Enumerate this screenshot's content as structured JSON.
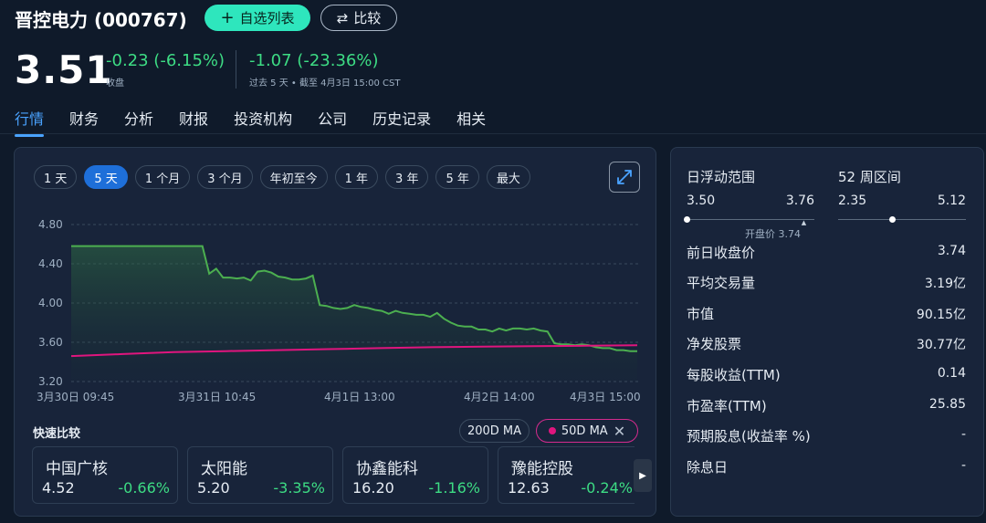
{
  "header": {
    "title": "晋控电力 (000767)",
    "watchlist_label": "自选列表",
    "compare_label": "比较",
    "price": "3.51",
    "change_today": "-0.23 (-6.15%)",
    "change_today_label": "收盘",
    "change_period": "-1.07 (-23.36%)",
    "change_period_label": "过去 5 天 • 截至 4月3日 15:00 CST"
  },
  "nav": {
    "tabs": [
      "行情",
      "财务",
      "分析",
      "财报",
      "投资机构",
      "公司",
      "历史记录",
      "相关"
    ],
    "active": "行情"
  },
  "chart_controls": {
    "ranges": [
      "1 天",
      "5 天",
      "1 个月",
      "3 个月",
      "年初至今",
      "1 年",
      "3 年",
      "5 年",
      "最大"
    ],
    "active_range": "5 天"
  },
  "chart_data": {
    "type": "line",
    "ylim": [
      3.2,
      4.8
    ],
    "yticks": [
      "4.80",
      "4.40",
      "4.00",
      "3.60",
      "3.20"
    ],
    "xtick_labels": [
      "3月30日 09:45",
      "3月31日 10:45",
      "4月1日 13:00",
      "4月2日 14:00",
      "4月3日 15:00"
    ],
    "grid": true,
    "series": [
      {
        "name": "price",
        "color": "#4caf50",
        "values": [
          4.58,
          4.58,
          4.58,
          4.58,
          4.58,
          4.58,
          4.58,
          4.58,
          4.58,
          4.58,
          4.58,
          4.58,
          4.58,
          4.58,
          4.58,
          4.58,
          4.58,
          4.58,
          4.58,
          4.58,
          4.3,
          4.35,
          4.26,
          4.26,
          4.25,
          4.26,
          4.23,
          4.32,
          4.33,
          4.31,
          4.27,
          4.26,
          4.24,
          4.24,
          4.25,
          4.28,
          3.98,
          3.97,
          3.95,
          3.94,
          3.95,
          3.98,
          3.96,
          3.95,
          3.93,
          3.92,
          3.89,
          3.92,
          3.9,
          3.89,
          3.88,
          3.88,
          3.86,
          3.9,
          3.84,
          3.8,
          3.77,
          3.76,
          3.76,
          3.73,
          3.73,
          3.71,
          3.74,
          3.72,
          3.74,
          3.74,
          3.73,
          3.74,
          3.72,
          3.71,
          3.59,
          3.58,
          3.58,
          3.57,
          3.58,
          3.57,
          3.55,
          3.54,
          3.54,
          3.52,
          3.52,
          3.51,
          3.51
        ]
      },
      {
        "name": "50D MA",
        "color": "#e0157e",
        "values": [
          3.46,
          3.48,
          3.5,
          3.51,
          3.52,
          3.53,
          3.54,
          3.55,
          3.555,
          3.56,
          3.565,
          3.57
        ]
      }
    ]
  },
  "quick_compare": {
    "title": "快速比较",
    "ma200_label": "200D MA",
    "ma50_label": "50D MA",
    "cards": [
      {
        "name": "中国广核",
        "price": "4.52",
        "change": "-0.66%"
      },
      {
        "name": "太阳能",
        "price": "5.20",
        "change": "-3.35%"
      },
      {
        "name": "协鑫能科",
        "price": "16.20",
        "change": "-1.16%"
      },
      {
        "name": "豫能控股",
        "price": "12.63",
        "change": "-0.24%"
      }
    ]
  },
  "stats": {
    "day_range_label": "日浮动范围",
    "day_low": "3.50",
    "day_high": "3.76",
    "open_label": "开盘价 3.74",
    "day_position": 0.0,
    "open_position": 0.92,
    "week52_label": "52 周区间",
    "week52_low": "2.35",
    "week52_high": "5.12",
    "week52_position": 0.42,
    "rows": [
      {
        "label": "前日收盘价",
        "value": "3.74"
      },
      {
        "label": "平均交易量",
        "value": "3.19亿"
      },
      {
        "label": "市值",
        "value": "90.15亿"
      },
      {
        "label": "净发股票",
        "value": "30.77亿"
      },
      {
        "label": "每股收益(TTM)",
        "value": "0.14"
      },
      {
        "label": "市盈率(TTM)",
        "value": "25.85"
      },
      {
        "label": "预期股息(收益率 %)",
        "value": "-"
      },
      {
        "label": "除息日",
        "value": "-"
      }
    ]
  }
}
